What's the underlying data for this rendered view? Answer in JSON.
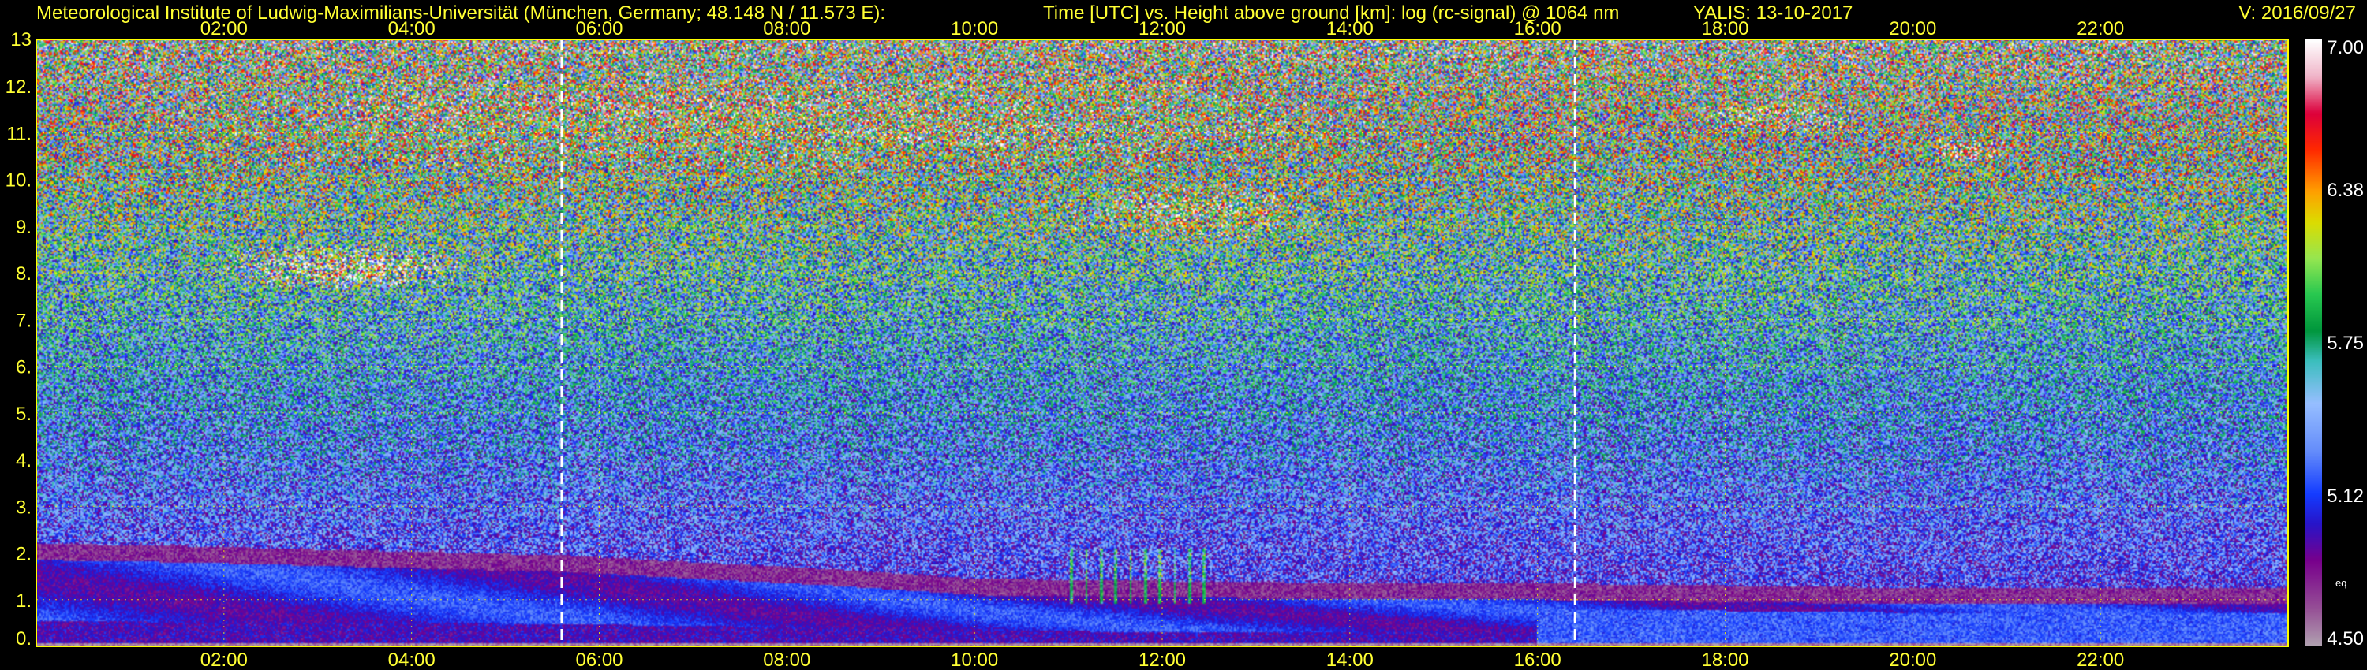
{
  "header": {
    "institute": "Meteorological Institute of Ludwig-Maximilians-Universität (München, Germany; 48.148 N / 11.573 E):",
    "axes_desc": "Time [UTC] vs. Height above ground [km]: log (rc-signal) @ 1064 nm",
    "station": "YALIS: 13-10-2017",
    "version": "V: 2016/09/27"
  },
  "chart_data": {
    "type": "heatmap",
    "x_range_hours": [
      0,
      24
    ],
    "x_ticks": [
      "02:00",
      "04:00",
      "06:00",
      "08:00",
      "10:00",
      "12:00",
      "14:00",
      "16:00",
      "18:00",
      "20:00",
      "22:00"
    ],
    "x_tick_hours": [
      2,
      4,
      6,
      8,
      10,
      12,
      14,
      16,
      18,
      20,
      22
    ],
    "y_range_km": [
      0,
      13
    ],
    "y_ticks": [
      "0.",
      "1.",
      "2.",
      "3.",
      "4.",
      "5.",
      "6.",
      "7.",
      "8.",
      "9.",
      "10.",
      "11.",
      "12.",
      "13"
    ],
    "y_tick_values": [
      0,
      1,
      2,
      3,
      4,
      5,
      6,
      7,
      8,
      9,
      10,
      11,
      12,
      13
    ],
    "marker_lines_hours": [
      5.6,
      16.4
    ],
    "colorbar": {
      "range": [
        4.5,
        7.0
      ],
      "tick_labels": [
        "4.50",
        "5.12",
        "5.75",
        "6.38",
        "7.00"
      ],
      "tick_values": [
        4.5,
        5.12,
        5.75,
        6.38,
        7.0
      ],
      "small_label": "eq"
    },
    "grid": true,
    "colors": {
      "grid": "#ffff00",
      "text": "#ffff33",
      "marker": "#ffffff",
      "background": "#000000"
    },
    "features": {
      "boundary_layer_top_km": [
        [
          0.0,
          1.85
        ],
        [
          1.5,
          1.8
        ],
        [
          3.5,
          1.7
        ],
        [
          5.6,
          1.6
        ],
        [
          7.0,
          1.45
        ],
        [
          8.5,
          1.3
        ],
        [
          10.0,
          1.1
        ],
        [
          12.0,
          1.05
        ],
        [
          14.0,
          1.0
        ],
        [
          16.0,
          1.0
        ],
        [
          18.0,
          0.95
        ],
        [
          20.0,
          0.9
        ],
        [
          22.0,
          0.9
        ],
        [
          24.0,
          0.9
        ]
      ],
      "cloud_patches": [
        {
          "t0": 2.0,
          "t1": 4.6,
          "h0": 7.6,
          "h1": 8.6,
          "level": 6.5
        },
        {
          "t0": 10.8,
          "t1": 13.8,
          "h0": 8.6,
          "h1": 10.0,
          "level": 6.1
        },
        {
          "t0": 0.8,
          "t1": 15.0,
          "h0": 10.0,
          "h1": 12.3,
          "level": 6.0
        },
        {
          "t0": 17.6,
          "t1": 19.4,
          "h0": 11.0,
          "h1": 11.7,
          "level": 6.2
        },
        {
          "t0": 20.2,
          "t1": 21.0,
          "h0": 10.3,
          "h1": 10.9,
          "level": 6.3
        }
      ],
      "convective_plumes": [
        {
          "t0": 11.0,
          "t1": 12.5,
          "h0": 0.9,
          "h1": 2.1
        }
      ]
    }
  }
}
